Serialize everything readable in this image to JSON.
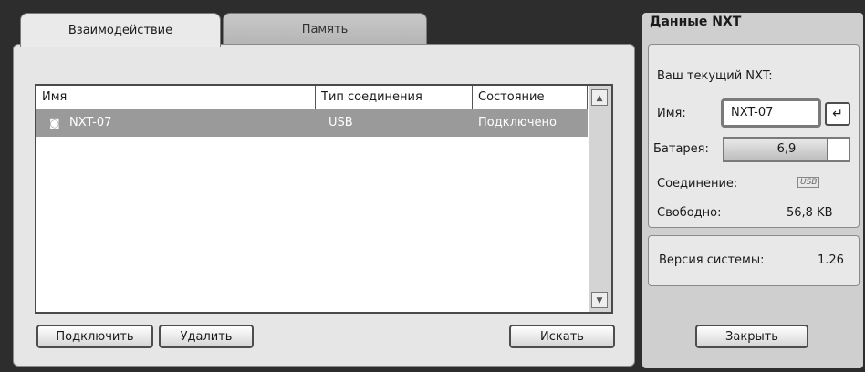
{
  "tabs": [
    {
      "label": "Взаимодействие",
      "active": true
    },
    {
      "label": "Память",
      "active": false
    }
  ],
  "device_list": {
    "columns": [
      "Имя",
      "Тип соединения",
      "Состояние"
    ],
    "rows": [
      {
        "name": "NXT-07",
        "connection": "USB",
        "status": "Подключено",
        "selected": true
      }
    ]
  },
  "buttons": {
    "connect": "Подключить",
    "delete": "Удалить",
    "search": "Искать",
    "close": "Закрыть"
  },
  "nxt_data": {
    "title": "Данные NXT",
    "current_label": "Ваш текущий NXT:",
    "name_label": "Имя:",
    "name_value": "NXT-07",
    "battery_label": "Батарея:",
    "battery_value": "6,9",
    "battery_level": 0.82,
    "connection_label": "Соединение:",
    "connection_value": "USB",
    "free_label": "Свободно:",
    "free_value": "56,8 KB",
    "version_label": "Версия системы:",
    "version_value": "1.26"
  },
  "icons": {
    "enter": "return-arrow",
    "device": "nxt-device",
    "usb": "usb-badge"
  }
}
